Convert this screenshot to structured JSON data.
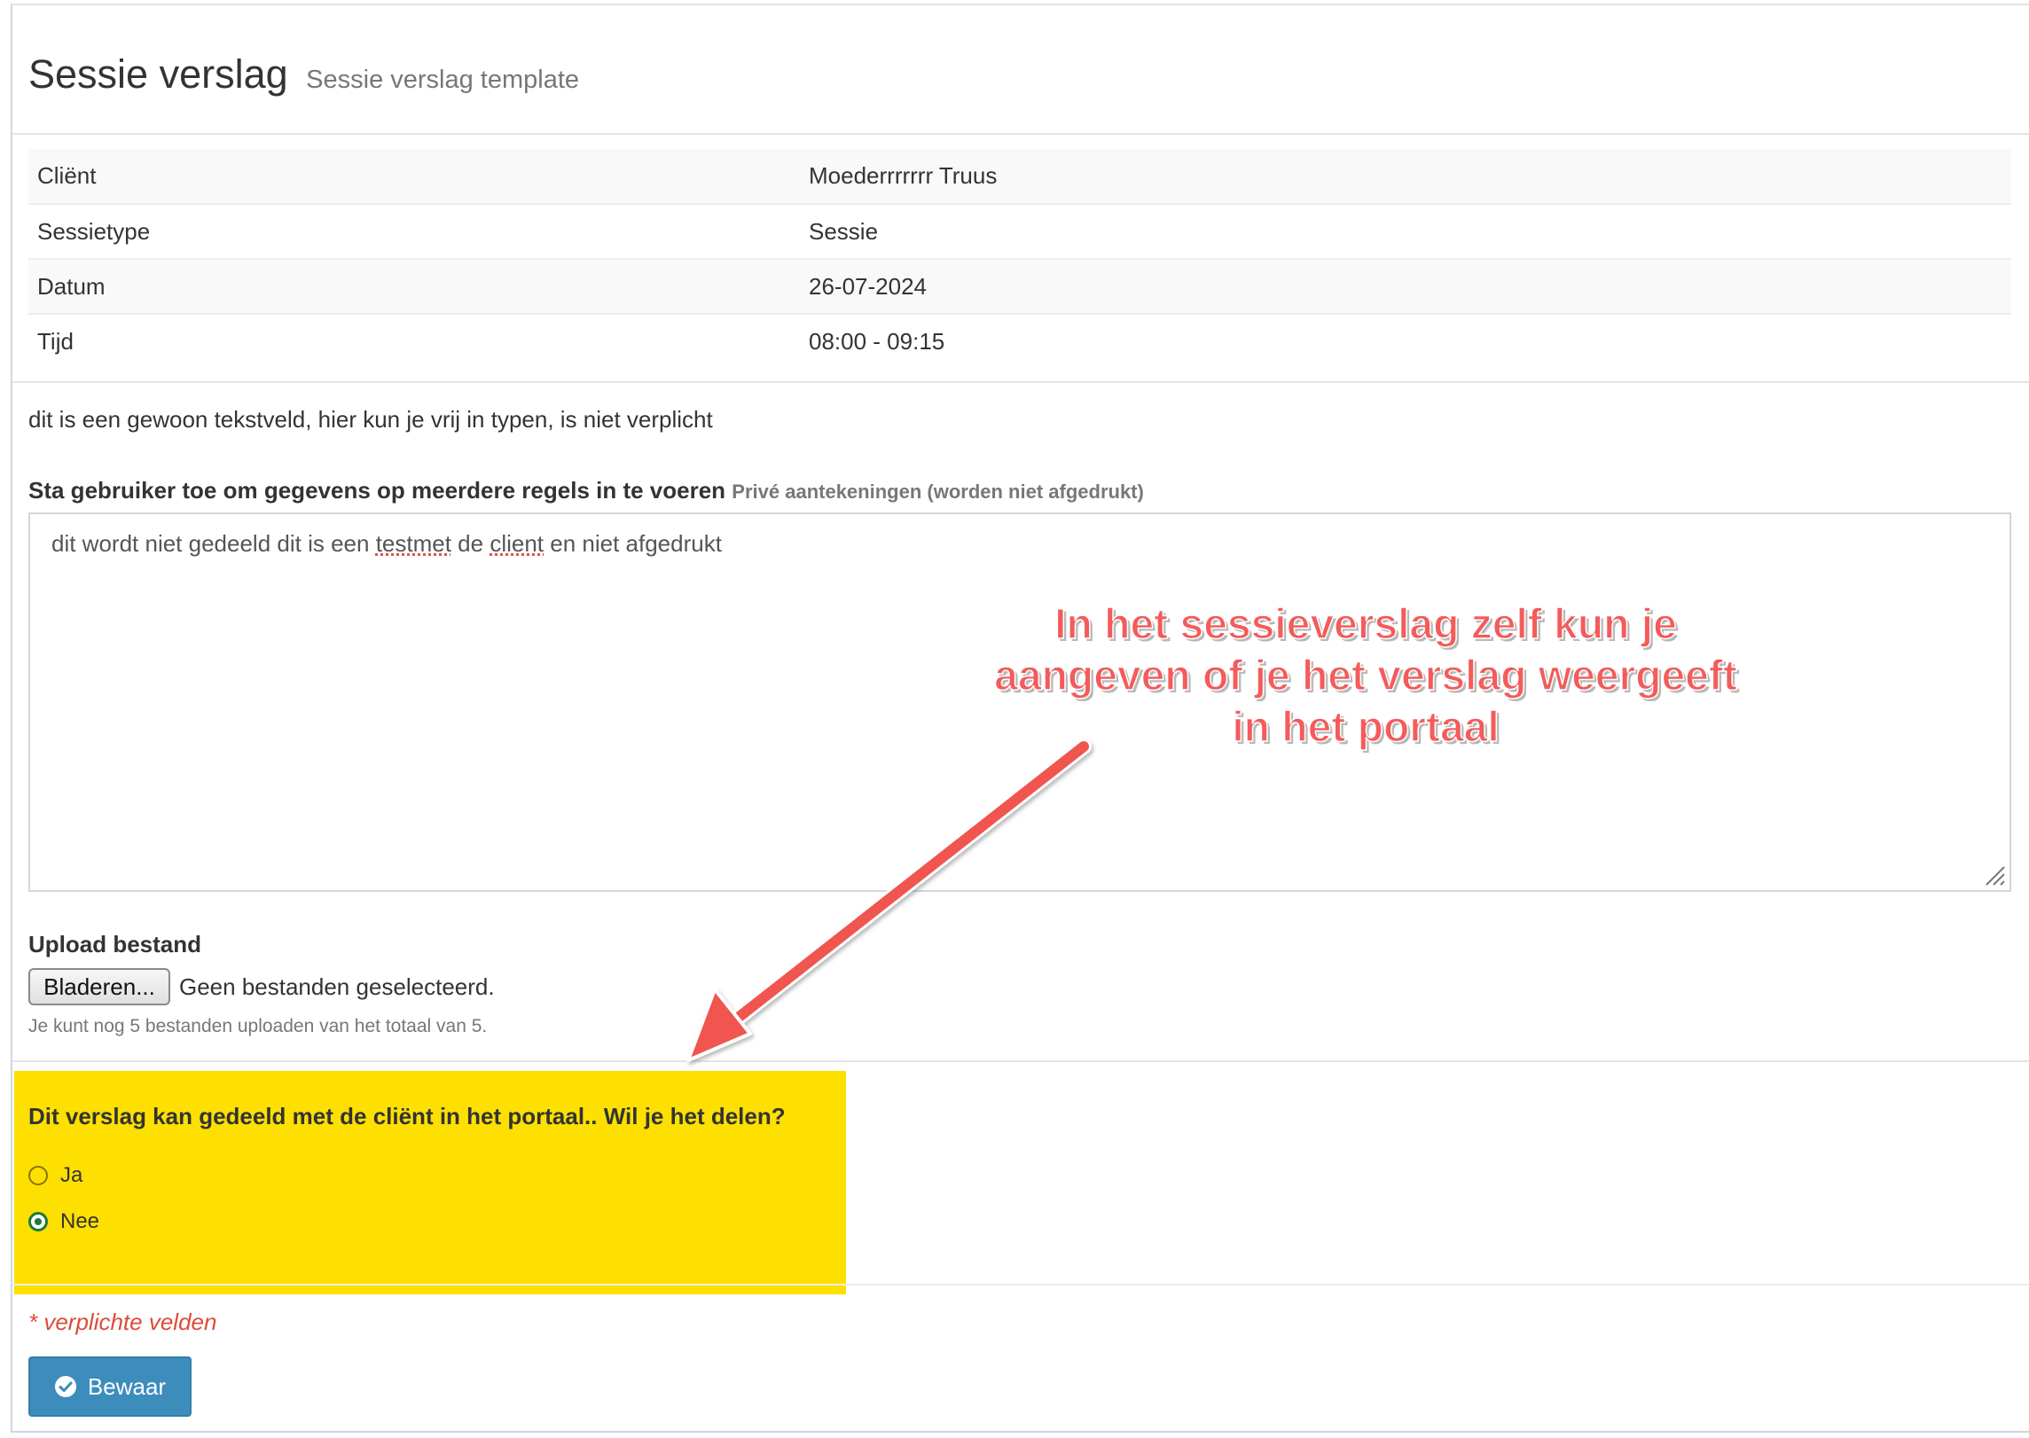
{
  "header": {
    "title": "Sessie verslag",
    "subtitle": "Sessie verslag template"
  },
  "info_table": {
    "rows": [
      {
        "label": "Cliënt",
        "value": "Moederrrrrrr Truus"
      },
      {
        "label": "Sessietype",
        "value": "Sessie"
      },
      {
        "label": "Datum",
        "value": "26-07-2024"
      },
      {
        "label": "Tijd",
        "value": "08:00 - 09:15"
      }
    ]
  },
  "text_field": {
    "value": "dit is een gewoon tekstveld, hier kun je vrij in typen, is niet verplicht"
  },
  "notes": {
    "label": "Sta gebruiker toe om gegevens op meerdere regels in te voeren",
    "hint": "Privé aantekeningen (worden niet afgedrukt)",
    "value_part1": "dit wordt niet gedeeld dit is een ",
    "value_misspelled1": "testmet",
    "value_part2": " de ",
    "value_misspelled2": "client",
    "value_part3": " en niet afgedrukt"
  },
  "upload": {
    "label": "Upload bestand",
    "button_label": "Bladeren...",
    "status": "Geen bestanden geselecteerd.",
    "help": "Je kunt nog 5 bestanden uploaden van het totaal van 5."
  },
  "share": {
    "question": "Dit verslag kan gedeeld met de cliënt in het portaal.. Wil je het delen?",
    "options": [
      {
        "label": "Ja",
        "checked": false
      },
      {
        "label": "Nee",
        "checked": true
      }
    ],
    "highlight_color": "#fde000"
  },
  "form": {
    "required_note": "* verplichte velden",
    "save_label": "Bewaar",
    "save_icon": "check-circle-icon"
  },
  "annotation": {
    "line1": "In het sessieverslag zelf kun je",
    "line2": "aangeven of je het verslag weergeeft",
    "line3": "in het portaal",
    "color": "#f45b5b"
  }
}
